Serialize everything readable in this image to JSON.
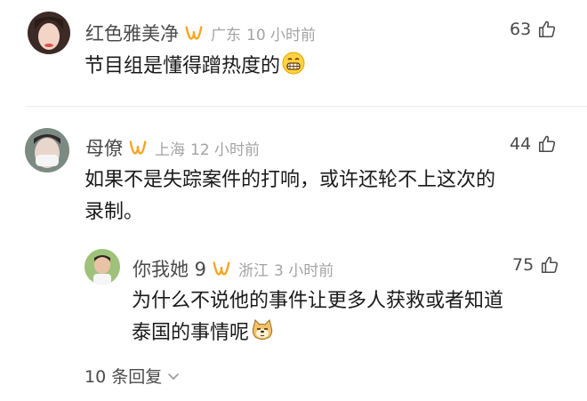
{
  "comments": [
    {
      "name": "红色雅美净",
      "location": "广东",
      "time": "10 小时前",
      "likes": "63",
      "text": "节目组是懂得蹭热度的",
      "emoji": "grin-emoji"
    },
    {
      "name": "母僚",
      "location": "上海",
      "time": "12 小时前",
      "likes": "44",
      "text_line1": "如果不是失踪案件的打响，或许还轮不上这次的",
      "text_line2": "录制。"
    }
  ],
  "reply": {
    "name": "你我她 9",
    "location": "浙江",
    "time": "3 小时前",
    "likes": "75",
    "text_line1": "为什么不说他的事件让更多人获救或者知道",
    "text_line2": "泰国的事情呢",
    "emoji": "doge-emoji"
  },
  "more_replies": "10 条回复",
  "colors": {
    "vip_badge": "#f5a623",
    "meta_gray": "#a3a3a3"
  }
}
